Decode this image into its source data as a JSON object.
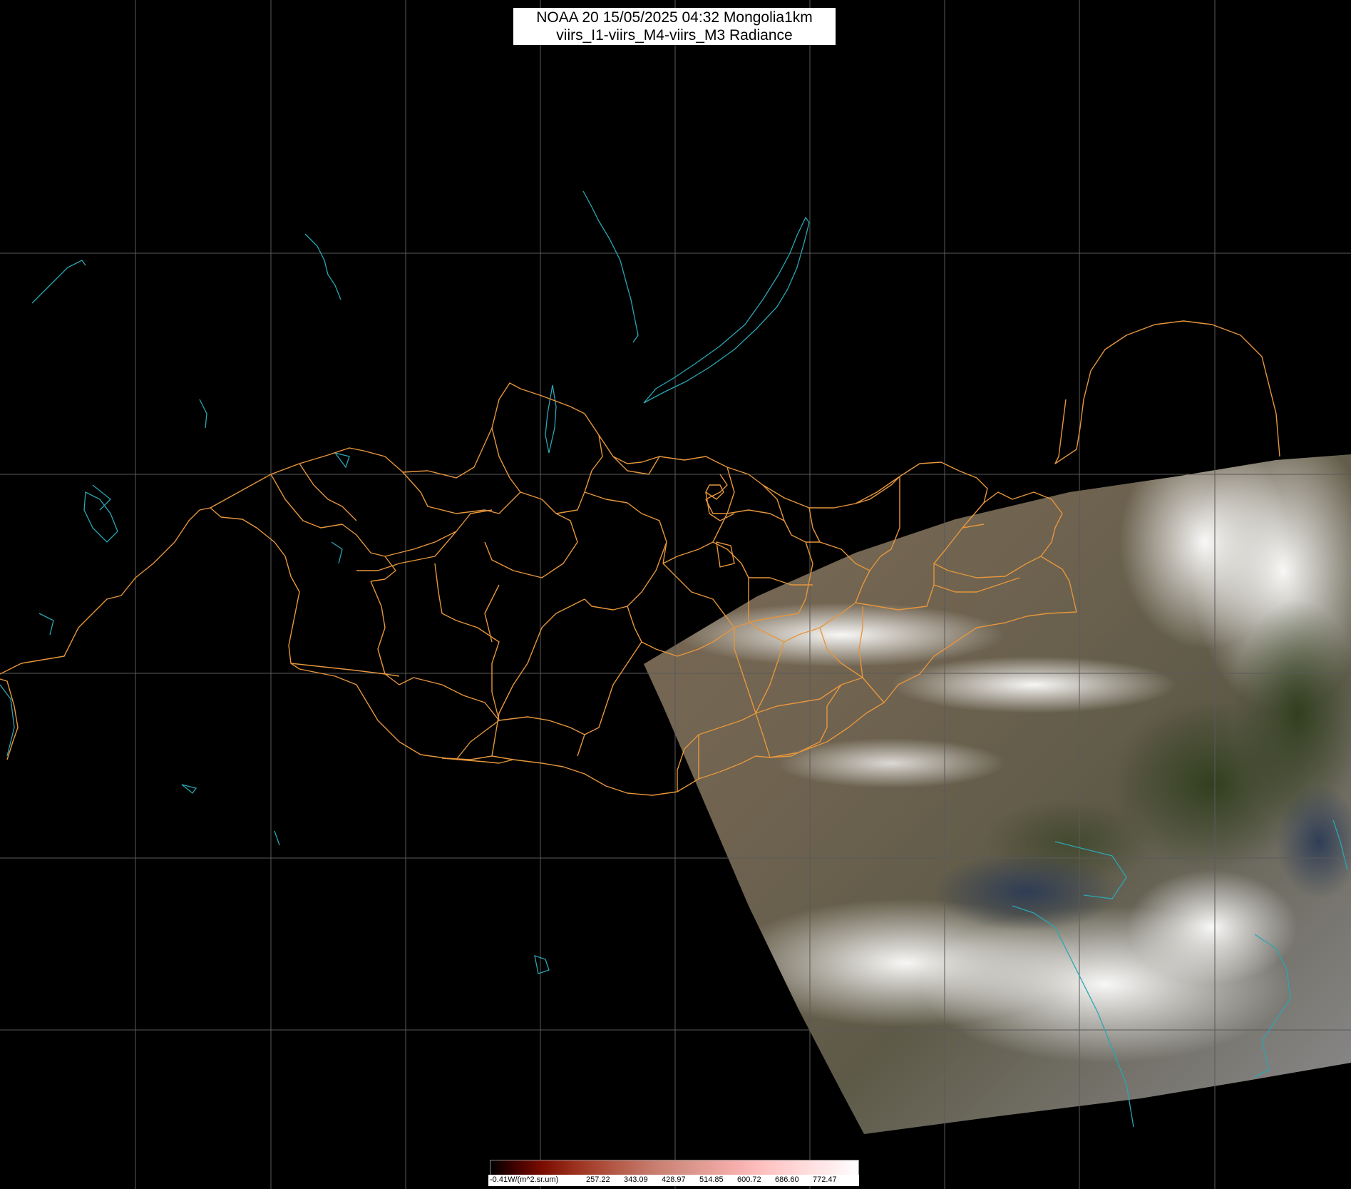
{
  "title": {
    "line1": "NOAA 20 15/05/2025 04:32 Mongolia1km",
    "line2": "viirs_I1-viirs_M4-viirs_M3 Radiance"
  },
  "legend": {
    "labels": [
      "-0.41W/(m^2.sr.um)",
      "257.22",
      "343.09",
      "428.97",
      "514.85",
      "600.72",
      "686.60",
      "772.47"
    ]
  },
  "colors": {
    "background": "#000000",
    "graticule": "#5a5a5a",
    "border": "#e6963c",
    "coastline": "#2aa6b3"
  }
}
